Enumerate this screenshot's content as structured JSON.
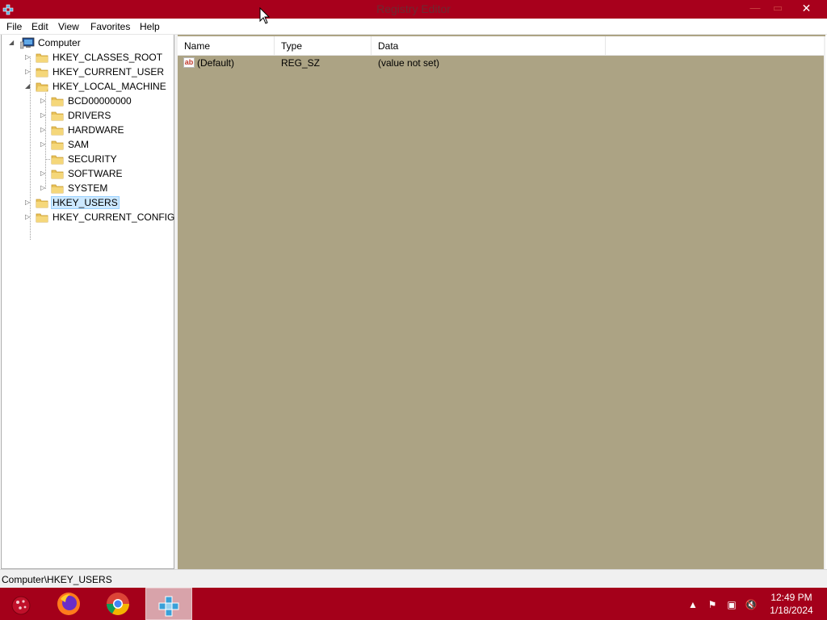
{
  "window": {
    "title": "Registry Editor",
    "controls": {
      "minimize": "—",
      "maximize": "▭",
      "close": "✕"
    }
  },
  "menu": [
    "File",
    "Edit",
    "View",
    "Favorites",
    "Help"
  ],
  "tree": {
    "root": "Computer",
    "items": [
      {
        "label": "HKEY_CLASSES_ROOT",
        "level": 1,
        "expander": "▷"
      },
      {
        "label": "HKEY_CURRENT_USER",
        "level": 1,
        "expander": "▷"
      },
      {
        "label": "HKEY_LOCAL_MACHINE",
        "level": 1,
        "expander": "◢"
      },
      {
        "label": "BCD00000000",
        "level": 2,
        "expander": "▷"
      },
      {
        "label": "DRIVERS",
        "level": 2,
        "expander": "▷"
      },
      {
        "label": "HARDWARE",
        "level": 2,
        "expander": "▷"
      },
      {
        "label": "SAM",
        "level": 2,
        "expander": "▷"
      },
      {
        "label": "SECURITY",
        "level": 2,
        "expander": ""
      },
      {
        "label": "SOFTWARE",
        "level": 2,
        "expander": "▷"
      },
      {
        "label": "SYSTEM",
        "level": 2,
        "expander": "▷"
      },
      {
        "label": "HKEY_USERS",
        "level": 1,
        "expander": "▷",
        "selected": true
      },
      {
        "label": "HKEY_CURRENT_CONFIG",
        "level": 1,
        "expander": "▷"
      }
    ]
  },
  "list": {
    "columns": [
      "Name",
      "Type",
      "Data"
    ],
    "rows": [
      {
        "icon": "ab",
        "name": "(Default)",
        "type": "REG_SZ",
        "data": "(value not set)"
      }
    ]
  },
  "status": {
    "path": "Computer\\HKEY_USERS"
  },
  "taskbar": {
    "apps": [
      "start-icon",
      "firefox-icon",
      "chrome-icon",
      "regedit-icon"
    ],
    "clock": {
      "time": "12:49 PM",
      "date": "1/18/2024"
    }
  },
  "colors": {
    "titlebar": "#a8001c",
    "taskbar": "#a4001a",
    "list_background": "#aca384",
    "selection": "#cce8ff"
  }
}
